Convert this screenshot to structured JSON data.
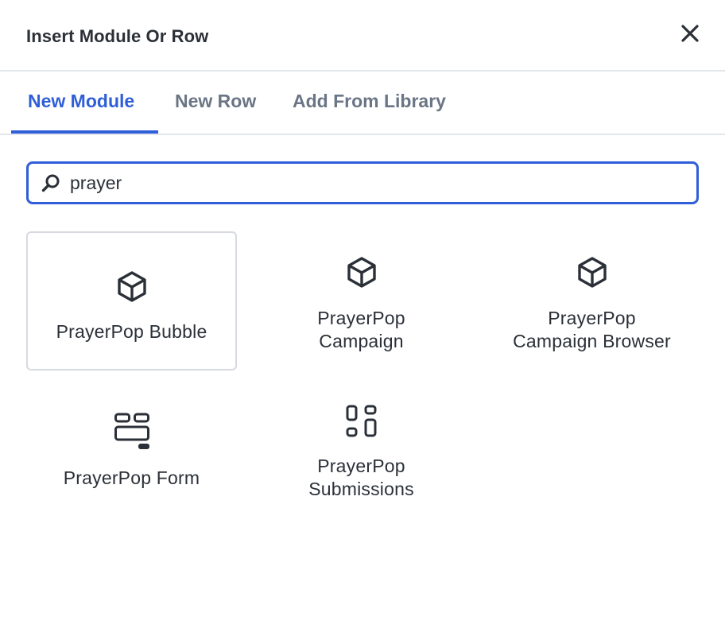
{
  "dialog": {
    "title": "Insert Module Or Row",
    "close_icon": "close-icon"
  },
  "tabs": [
    {
      "label": "New Module",
      "active": true
    },
    {
      "label": "New Row",
      "active": false
    },
    {
      "label": "Add From Library",
      "active": false
    }
  ],
  "search": {
    "icon": "search-icon",
    "value": "prayer",
    "placeholder": ""
  },
  "modules": [
    {
      "line1": "PrayerPop Bubble",
      "line2": "",
      "icon": "cube-icon",
      "selected": true
    },
    {
      "line1": "PrayerPop",
      "line2": "Campaign",
      "icon": "cube-icon",
      "selected": false
    },
    {
      "line1": "PrayerPop",
      "line2": "Campaign Browser",
      "icon": "cube-icon",
      "selected": false
    },
    {
      "line1": "PrayerPop Form",
      "line2": "",
      "icon": "form-layout-icon",
      "selected": false
    },
    {
      "line1": "PrayerPop",
      "line2": "Submissions",
      "icon": "grid-layout-icon",
      "selected": false
    }
  ],
  "colors": {
    "accent": "#2f5ed8",
    "text": "#2b3038",
    "tab_inactive": "#6a7585",
    "border": "#e3e6ea"
  }
}
